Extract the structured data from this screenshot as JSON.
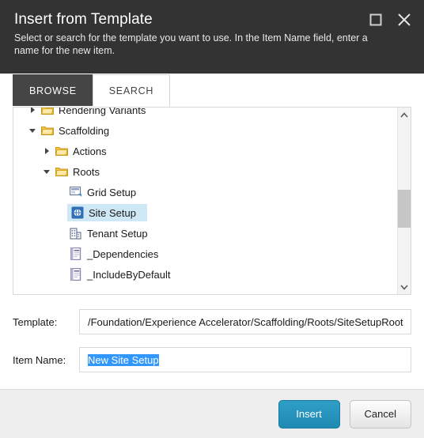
{
  "header": {
    "title": "Insert from Template",
    "description": "Select or search for the template you want to use. In the Item Name field, enter a name for the new item.",
    "maximize_icon": "maximize-square-icon",
    "close_icon": "close-x-icon"
  },
  "tabs": [
    {
      "label": "BROWSE",
      "active": true
    },
    {
      "label": "SEARCH",
      "active": false
    }
  ],
  "tree": {
    "rows": [
      {
        "label": "Rendering Variants",
        "indent": 1,
        "twisty": "collapsed",
        "icon": "folder-icon",
        "selected": false,
        "clipped": true
      },
      {
        "label": "Scaffolding",
        "indent": 1,
        "twisty": "expanded",
        "icon": "folder-icon",
        "selected": false
      },
      {
        "label": "Actions",
        "indent": 2,
        "twisty": "collapsed",
        "icon": "folder-icon",
        "selected": false
      },
      {
        "label": "Roots",
        "indent": 2,
        "twisty": "expanded",
        "icon": "folder-icon",
        "selected": false
      },
      {
        "label": "Grid Setup",
        "indent": 3,
        "twisty": "none",
        "icon": "grid-layout-icon",
        "selected": false
      },
      {
        "label": "Site Setup",
        "indent": 3,
        "twisty": "none",
        "icon": "globe-icon",
        "selected": true
      },
      {
        "label": "Tenant Setup",
        "indent": 3,
        "twisty": "none",
        "icon": "building-icon",
        "selected": false
      },
      {
        "label": "_Dependencies",
        "indent": 3,
        "twisty": "none",
        "icon": "document-list-icon",
        "selected": false
      },
      {
        "label": "_IncludeByDefault",
        "indent": 3,
        "twisty": "none",
        "icon": "document-list-icon",
        "selected": false
      }
    ],
    "scrollbar": {
      "up_arrow": "chevron-up-icon",
      "down_arrow": "chevron-down-icon"
    }
  },
  "form": {
    "template": {
      "label": "Template:",
      "value": "/Foundation/Experience Accelerator/Scaffolding/Roots/SiteSetupRoot"
    },
    "item_name": {
      "label": "Item Name:",
      "value": "New Site Setup",
      "selected": true
    }
  },
  "footer": {
    "insert_label": "Insert",
    "cancel_label": "Cancel"
  },
  "colors": {
    "header_bg": "#333333",
    "tab_active_bg": "#454545",
    "tree_selection": "#cfe8f5",
    "text_selection": "#3297fd",
    "primary_button": "#1f8ab3",
    "footer_bg": "#eeeeee"
  }
}
